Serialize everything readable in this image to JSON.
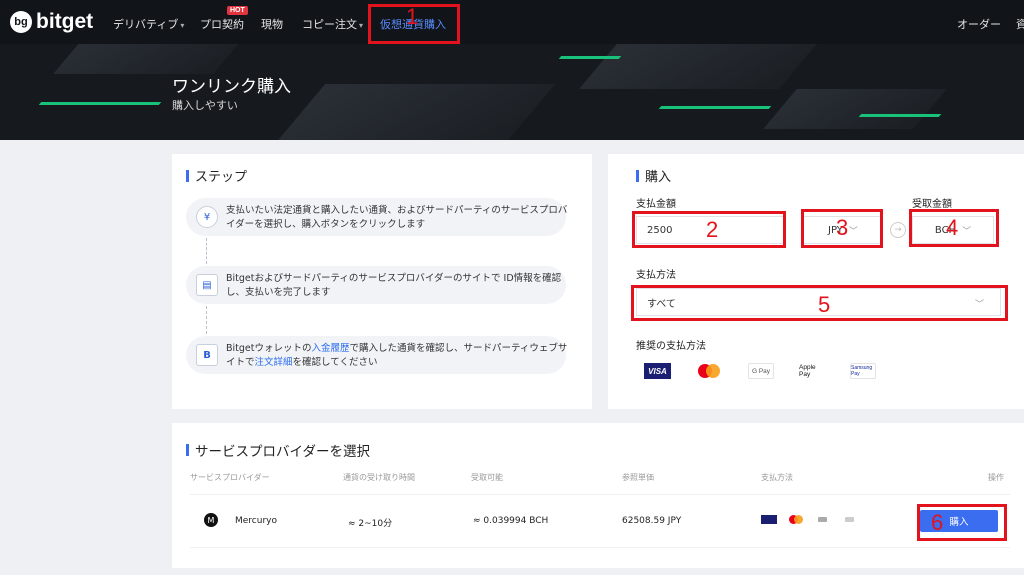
{
  "nav": {
    "brand": "bitget",
    "items": [
      {
        "label": "デリバティブ",
        "caret": "▾"
      },
      {
        "label": "プロ契約",
        "badge": "HOT"
      },
      {
        "label": "現物"
      },
      {
        "label": "コピー注文",
        "caret": "▾"
      },
      {
        "label": "仮想通貨購入"
      }
    ],
    "right": "オーダー",
    "right_cut": "資"
  },
  "hero": {
    "title": "ワンリンク購入",
    "subtitle": "購入しやすい"
  },
  "steps": {
    "title": "ステップ",
    "items": [
      {
        "text": "支払いたい法定通貨と購入したい通貨、およびサードパーティのサービスプロバイダーを選択し、購入ボタンをクリックします",
        "icon": "yen-exchange-icon"
      },
      {
        "text": "Bitgetおよびサードパーティのサービスプロバイダーのサイトで ID情報を確認し、支払いを完了します",
        "icon": "id-card-icon"
      },
      {
        "pre": "Bitgetウォレットの",
        "link1": "入金履歴",
        "mid": "で購入した通貨を確認し、サードパーティウェブサイトで",
        "link2": "注文詳細",
        "post": "を確認してください",
        "icon": "bitget-b-icon"
      }
    ]
  },
  "buy": {
    "title": "購入",
    "pay_label": "支払金額",
    "pay_value": "2500",
    "fiat": "JPY",
    "receive_label": "受取金額",
    "crypto": "BCH",
    "method_label": "支払方法",
    "method_value": "すべて",
    "recommended_label": "推奨の支払方法",
    "logos": [
      "VISA",
      "mastercard",
      "G Pay",
      "Apple Pay",
      "Samsung Pay"
    ]
  },
  "providers": {
    "title": "サービスプロバイダーを選択",
    "headers": [
      "サービスプロバイダー",
      "通貨の受け取り時間",
      "受取可能",
      "参照単価",
      "支払方法",
      "操作"
    ],
    "rows": [
      {
        "name": "Mercuryo",
        "time": "≈ 2~10分",
        "amount": "≈ 0.039994 BCH",
        "price": "62508.59 JPY",
        "action": "購入"
      }
    ]
  },
  "annotations": [
    "1",
    "2",
    "3",
    "4",
    "5",
    "6"
  ],
  "colors": {
    "accent": "#3a6df0",
    "annotation": "#e2131c",
    "nav_bg": "#111418"
  }
}
